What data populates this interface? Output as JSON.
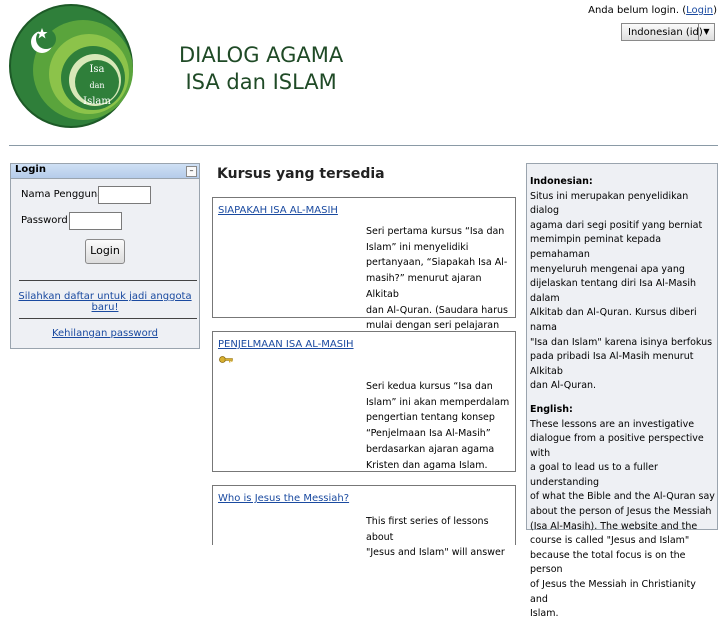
{
  "header": {
    "logo_text": [
      "Isa",
      "dan",
      "Islam"
    ],
    "title_line1": "DIALOG AGAMA",
    "title_line2": "ISA dan ISLAM",
    "login_info_prefix": "Anda belum login. (",
    "login_link": "Login",
    "login_info_suffix": ")",
    "language_selected": "Indonesian (id)"
  },
  "login_block": {
    "title": "Login",
    "collapse_symbol": "–",
    "username_label": "Nama Pengguna",
    "password_label": "Password",
    "login_button": "Login",
    "signup_link": "Silahkan daftar untuk jadi anggota baru!",
    "forgot_link": "Kehilangan password"
  },
  "main": {
    "title": "Kursus yang tersedia",
    "courses": [
      {
        "name": "SIAPAKAH ISA AL-MASIH",
        "summary": [
          "Seri pertama kursus “Isa dan",
          "Islam” ini menyelidiki",
          "pertanyaan, “Siapakah Isa Al-",
          "masih?” menurut ajaran Alkitab",
          "dan Al-Quran. (Saudara harus",
          "mulai dengan seri pelajaran ini)"
        ]
      },
      {
        "name": "PENJELMAAN ISA AL-MASIH",
        "summary": [
          "Seri kedua kursus “Isa dan",
          "Islam” ini akan memperdalam",
          "pengertian tentang konsep",
          "“Penjelmaan Isa Al-Masih”",
          "berdasarkan ajaran agama",
          "Kristen dan agama Islam."
        ]
      },
      {
        "name": "Who is Jesus the Messiah?",
        "summary": [
          "This first series of lessons about",
          "\"Jesus and Islam\" will answer"
        ]
      }
    ]
  },
  "description": {
    "indo_heading": "Indonesian:",
    "indo_lines": [
      "Situs ini merupakan penyelidikan dialog",
      "agama dari segi positif yang berniat",
      "memimpin peminat kepada pemahaman",
      "menyeluruh mengenai apa yang",
      "dijelaskan tentang diri Isa Al-Masih dalam",
      "Alkitab dan Al-Quran. Kursus diberi nama",
      "\"Isa dan Islam\" karena isinya berfokus",
      "pada pribadi Isa Al-Masih menurut Alkitab",
      "dan Al-Quran."
    ],
    "eng_heading": "English:",
    "eng_lines": [
      "These lessons are an investigative",
      "dialogue from a positive perspective with",
      "a goal to lead us to a fuller understanding",
      "of what the Bible and the Al-Quran say",
      "about the person of Jesus the Messiah",
      "(Isa Al-Masih). The website and the",
      "course is called \"Jesus and Islam\"",
      "because the total focus is on the person",
      "of Jesus the Messiah in Christianity and",
      "Islam."
    ]
  },
  "colors": {
    "logo_green": "#2e7d3a",
    "title_green": "#1f4a26",
    "link_blue": "#1a4aa0"
  }
}
